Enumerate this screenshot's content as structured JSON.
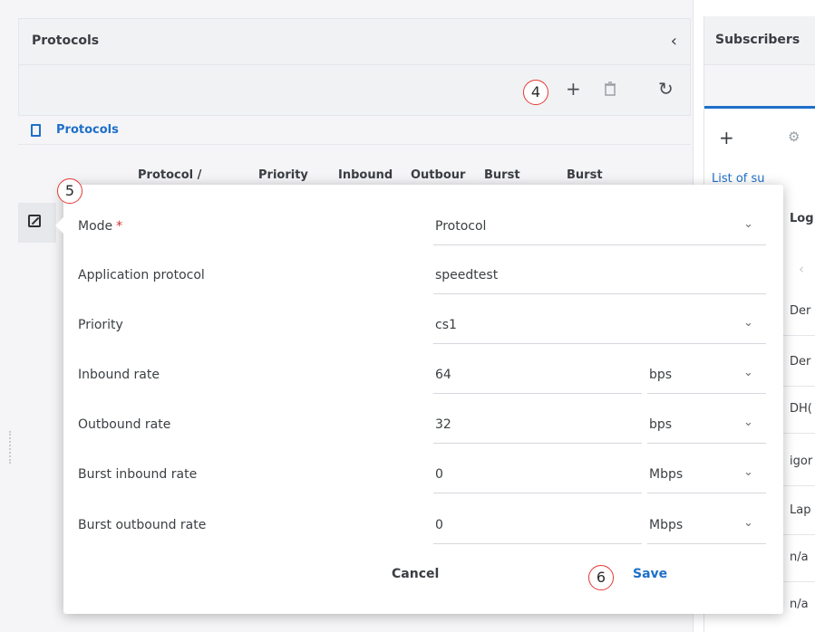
{
  "left_panel": {
    "title": "Protocols",
    "collapse_glyph": "‹",
    "toolbar": {
      "add": "+",
      "delete": "🗑",
      "refresh": "↻"
    },
    "tree_label": "Protocols",
    "columns": [
      "Protocol /",
      "Priority",
      "Inbound",
      "Outbour",
      "Burst",
      "Burst"
    ]
  },
  "right_panel": {
    "title": "Subscribers",
    "add": "+",
    "gear": "⚙",
    "list_label": "List of su",
    "column_login": "Log",
    "chevron": "‹",
    "rows": [
      "Der",
      "Der",
      "DH(",
      "igor",
      "Lap",
      "n/a",
      "n/a"
    ]
  },
  "modal": {
    "fields": [
      {
        "label": "Mode",
        "required": true,
        "value": "Protocol",
        "unit": "",
        "dropdown": true
      },
      {
        "label": "Application protocol",
        "required": false,
        "value": "speedtest",
        "unit": "",
        "dropdown": false
      },
      {
        "label": "Priority",
        "required": false,
        "value": "cs1",
        "unit": "",
        "dropdown": true
      },
      {
        "label": "Inbound rate",
        "required": false,
        "value": "64",
        "unit": "bps",
        "dropdown": true
      },
      {
        "label": "Outbound rate",
        "required": false,
        "value": "32",
        "unit": "bps",
        "dropdown": true
      },
      {
        "label": "Burst inbound rate",
        "required": false,
        "value": "0",
        "unit": "Mbps",
        "dropdown": true
      },
      {
        "label": "Burst outbound rate",
        "required": false,
        "value": "0",
        "unit": "Mbps",
        "dropdown": true
      }
    ],
    "required_mark": "*",
    "cancel_label": "Cancel",
    "save_label": "Save"
  },
  "steps": {
    "add": "4",
    "modal": "5",
    "save": "6"
  },
  "colors": {
    "accent": "#1e6fc9",
    "required": "#d32f2f",
    "callout": "#e53935"
  }
}
